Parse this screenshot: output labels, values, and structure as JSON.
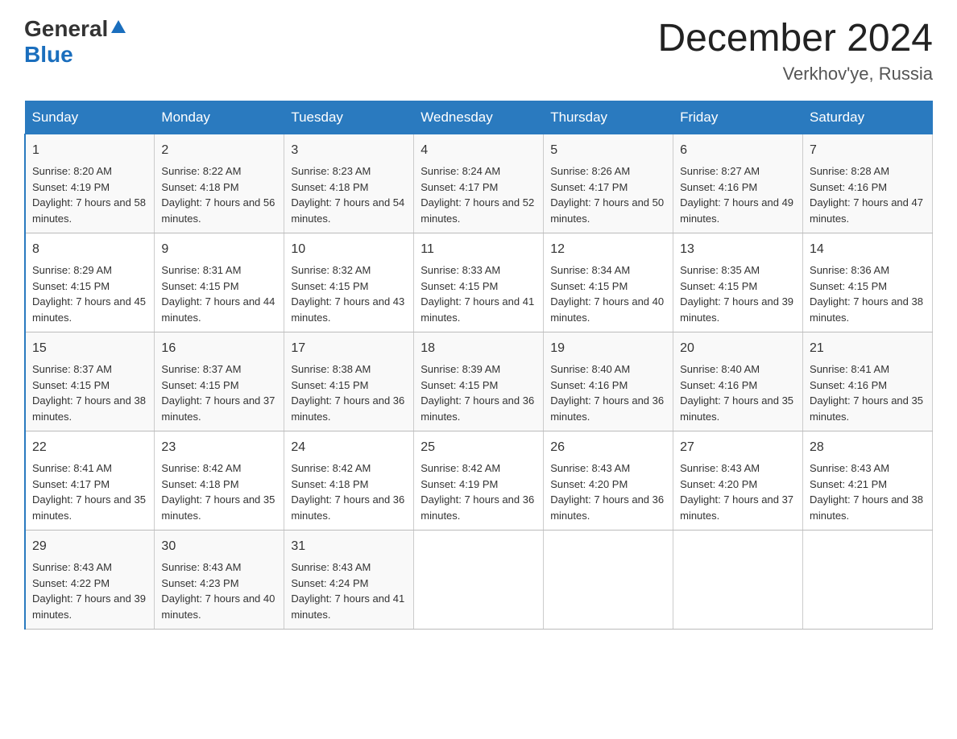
{
  "header": {
    "logo_general": "General",
    "logo_blue": "Blue",
    "month_title": "December 2024",
    "location": "Verkhov'ye, Russia"
  },
  "days_of_week": [
    "Sunday",
    "Monday",
    "Tuesday",
    "Wednesday",
    "Thursday",
    "Friday",
    "Saturday"
  ],
  "weeks": [
    [
      {
        "day": "1",
        "sunrise": "8:20 AM",
        "sunset": "4:19 PM",
        "daylight": "7 hours and 58 minutes."
      },
      {
        "day": "2",
        "sunrise": "8:22 AM",
        "sunset": "4:18 PM",
        "daylight": "7 hours and 56 minutes."
      },
      {
        "day": "3",
        "sunrise": "8:23 AM",
        "sunset": "4:18 PM",
        "daylight": "7 hours and 54 minutes."
      },
      {
        "day": "4",
        "sunrise": "8:24 AM",
        "sunset": "4:17 PM",
        "daylight": "7 hours and 52 minutes."
      },
      {
        "day": "5",
        "sunrise": "8:26 AM",
        "sunset": "4:17 PM",
        "daylight": "7 hours and 50 minutes."
      },
      {
        "day": "6",
        "sunrise": "8:27 AM",
        "sunset": "4:16 PM",
        "daylight": "7 hours and 49 minutes."
      },
      {
        "day": "7",
        "sunrise": "8:28 AM",
        "sunset": "4:16 PM",
        "daylight": "7 hours and 47 minutes."
      }
    ],
    [
      {
        "day": "8",
        "sunrise": "8:29 AM",
        "sunset": "4:15 PM",
        "daylight": "7 hours and 45 minutes."
      },
      {
        "day": "9",
        "sunrise": "8:31 AM",
        "sunset": "4:15 PM",
        "daylight": "7 hours and 44 minutes."
      },
      {
        "day": "10",
        "sunrise": "8:32 AM",
        "sunset": "4:15 PM",
        "daylight": "7 hours and 43 minutes."
      },
      {
        "day": "11",
        "sunrise": "8:33 AM",
        "sunset": "4:15 PM",
        "daylight": "7 hours and 41 minutes."
      },
      {
        "day": "12",
        "sunrise": "8:34 AM",
        "sunset": "4:15 PM",
        "daylight": "7 hours and 40 minutes."
      },
      {
        "day": "13",
        "sunrise": "8:35 AM",
        "sunset": "4:15 PM",
        "daylight": "7 hours and 39 minutes."
      },
      {
        "day": "14",
        "sunrise": "8:36 AM",
        "sunset": "4:15 PM",
        "daylight": "7 hours and 38 minutes."
      }
    ],
    [
      {
        "day": "15",
        "sunrise": "8:37 AM",
        "sunset": "4:15 PM",
        "daylight": "7 hours and 38 minutes."
      },
      {
        "day": "16",
        "sunrise": "8:37 AM",
        "sunset": "4:15 PM",
        "daylight": "7 hours and 37 minutes."
      },
      {
        "day": "17",
        "sunrise": "8:38 AM",
        "sunset": "4:15 PM",
        "daylight": "7 hours and 36 minutes."
      },
      {
        "day": "18",
        "sunrise": "8:39 AM",
        "sunset": "4:15 PM",
        "daylight": "7 hours and 36 minutes."
      },
      {
        "day": "19",
        "sunrise": "8:40 AM",
        "sunset": "4:16 PM",
        "daylight": "7 hours and 36 minutes."
      },
      {
        "day": "20",
        "sunrise": "8:40 AM",
        "sunset": "4:16 PM",
        "daylight": "7 hours and 35 minutes."
      },
      {
        "day": "21",
        "sunrise": "8:41 AM",
        "sunset": "4:16 PM",
        "daylight": "7 hours and 35 minutes."
      }
    ],
    [
      {
        "day": "22",
        "sunrise": "8:41 AM",
        "sunset": "4:17 PM",
        "daylight": "7 hours and 35 minutes."
      },
      {
        "day": "23",
        "sunrise": "8:42 AM",
        "sunset": "4:18 PM",
        "daylight": "7 hours and 35 minutes."
      },
      {
        "day": "24",
        "sunrise": "8:42 AM",
        "sunset": "4:18 PM",
        "daylight": "7 hours and 36 minutes."
      },
      {
        "day": "25",
        "sunrise": "8:42 AM",
        "sunset": "4:19 PM",
        "daylight": "7 hours and 36 minutes."
      },
      {
        "day": "26",
        "sunrise": "8:43 AM",
        "sunset": "4:20 PM",
        "daylight": "7 hours and 36 minutes."
      },
      {
        "day": "27",
        "sunrise": "8:43 AM",
        "sunset": "4:20 PM",
        "daylight": "7 hours and 37 minutes."
      },
      {
        "day": "28",
        "sunrise": "8:43 AM",
        "sunset": "4:21 PM",
        "daylight": "7 hours and 38 minutes."
      }
    ],
    [
      {
        "day": "29",
        "sunrise": "8:43 AM",
        "sunset": "4:22 PM",
        "daylight": "7 hours and 39 minutes."
      },
      {
        "day": "30",
        "sunrise": "8:43 AM",
        "sunset": "4:23 PM",
        "daylight": "7 hours and 40 minutes."
      },
      {
        "day": "31",
        "sunrise": "8:43 AM",
        "sunset": "4:24 PM",
        "daylight": "7 hours and 41 minutes."
      },
      null,
      null,
      null,
      null
    ]
  ]
}
